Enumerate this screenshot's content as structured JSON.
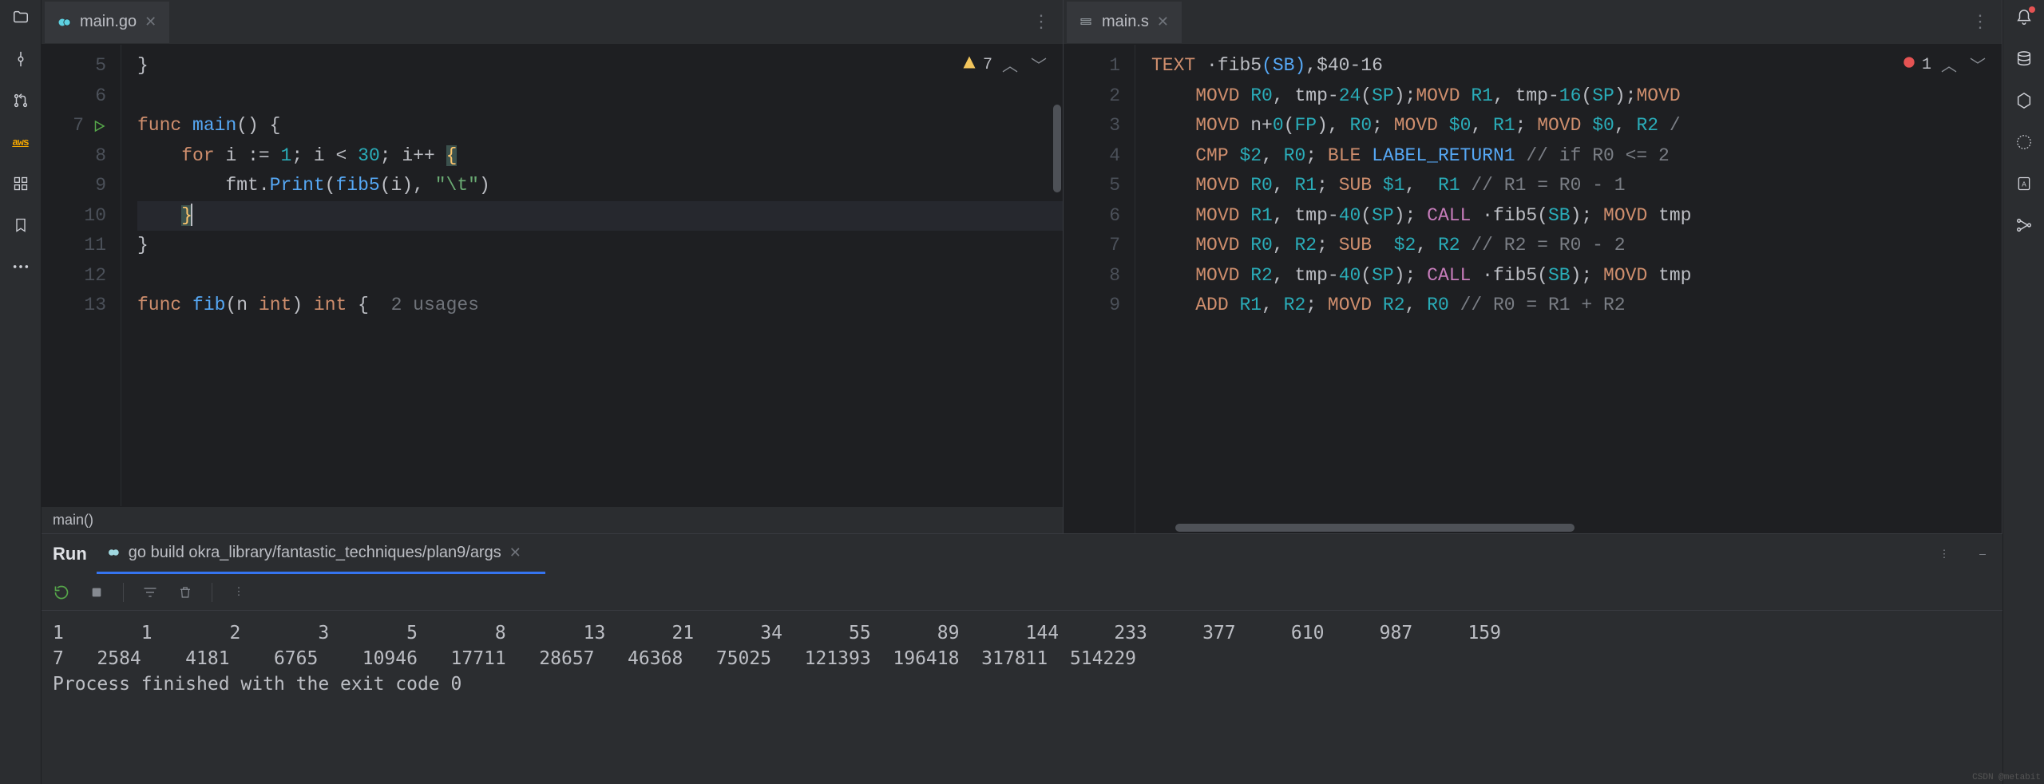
{
  "tabs": {
    "left": {
      "label": "main.go"
    },
    "right": {
      "label": "main.s"
    }
  },
  "inspections": {
    "left": {
      "count": "7"
    },
    "right": {
      "count": "1"
    }
  },
  "gutter_left": [
    "5",
    "6",
    "7",
    "8",
    "9",
    "10",
    "11",
    "12",
    "13"
  ],
  "gutter_right": [
    "1",
    "2",
    "3",
    "4",
    "5",
    "6",
    "7",
    "8",
    "9"
  ],
  "breadcrumb": "main()",
  "run": {
    "label": "Run",
    "config": "go build okra_library/fantastic_techniques/plan9/args"
  },
  "output_line1": "1       1       2       3       5       8       13      21      34      55      89      144     233     377     610     987     159",
  "output_line2": "7   2584    4181    6765    10946   17711   28657   46368   75025   121393  196418  317811  514229",
  "output_line3": "Process finished with the exit code 0",
  "watermark": "CSDN @metabit",
  "aws": "aws",
  "go_code": {
    "l5": "}",
    "l7_func": "func",
    "l7_main": "main",
    "l8_for": "for",
    "l8_i": "i",
    "l8_ass": ":=",
    "l8_one": "1",
    "l8_lt": "<",
    "l8_thirty": "30",
    "l8_inc": "i++",
    "l9_pkg": "fmt",
    "l9_print": "Print",
    "l9_fib": "fib5",
    "l9_tab": "\"\\t\"",
    "l10_brace": "}",
    "l11_brace": "}",
    "l13_func": "func",
    "l13_fib": "fib",
    "l13_n": "n",
    "l13_int1": "int",
    "l13_int2": "int",
    "l13_usage": "2 usages"
  },
  "asm": {
    "l1_text": "TEXT",
    "l1_sym": "·fib5",
    "l1_sb": "(SB)",
    "l1_fs": ",$40-16",
    "l2": "    MOVD R0, tmp-24(SP);MOVD R1, tmp-16(SP);MOVD",
    "l3": "    MOVD n+0(FP), R0; MOVD $0, R1; MOVD $0, R2 /",
    "l4": "    CMP $2, R0; BLE LABEL_RETURN1 // if R0 <= 2 ",
    "l5": "    MOVD R0, R1; SUB $1,  R1 // R1 = R0 - 1",
    "l6": "    MOVD R1, tmp-40(SP); CALL ·fib5(SB); MOVD tmp",
    "l7": "    MOVD R0, R2; SUB  $2, R2 // R2 = R0 - 2",
    "l8": "    MOVD R2, tmp-40(SP); CALL ·fib5(SB); MOVD tmp",
    "l9": "    ADD R1, R2; MOVD R2, R0 // R0 = R1 + R2"
  }
}
